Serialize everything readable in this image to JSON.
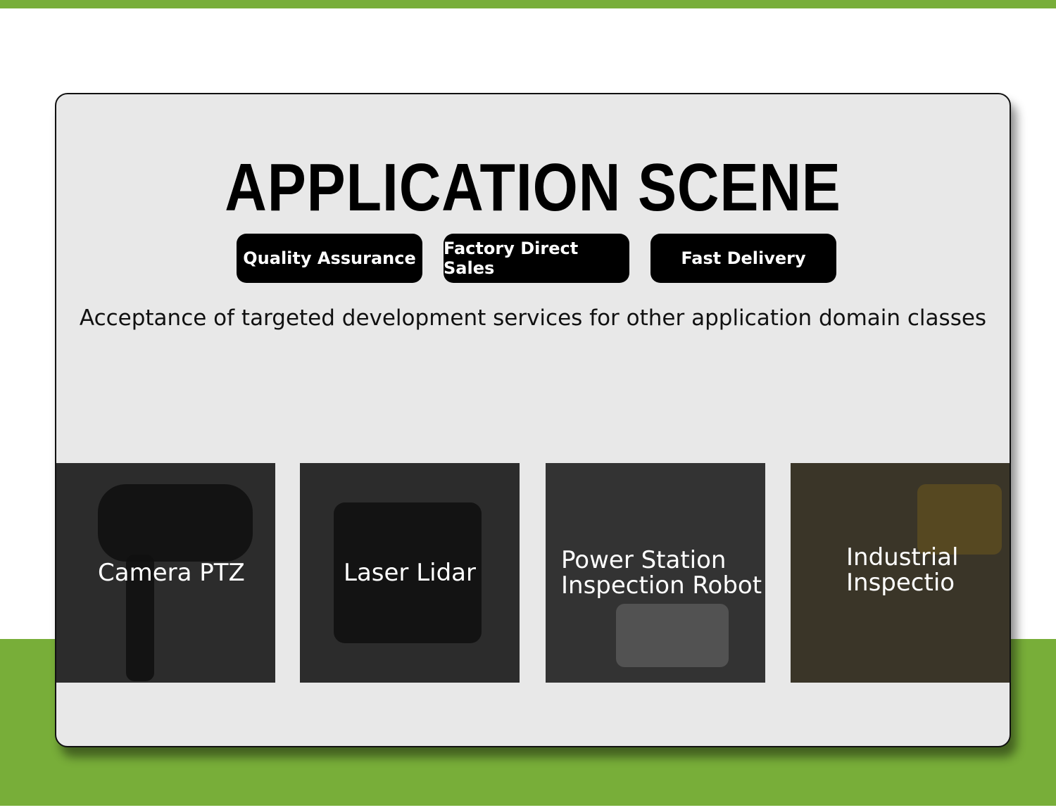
{
  "title": "APPLICATION SCENE",
  "badges": [
    "Quality Assurance",
    "Factory Direct Sales",
    "Fast Delivery"
  ],
  "description": "Acceptance of targeted development services for other application domain classes",
  "tiles": [
    {
      "label": "Camera PTZ"
    },
    {
      "label": "Laser Lidar"
    },
    {
      "label_line1": "Power Station",
      "label_line2": "Inspection Robot"
    },
    {
      "label_line1": "Industrial",
      "label_line2": "Inspectio"
    }
  ],
  "colors": {
    "brand_green": "#78ae39",
    "card_bg": "#e8e8e8",
    "tile_bg": "#2c2c2c"
  }
}
